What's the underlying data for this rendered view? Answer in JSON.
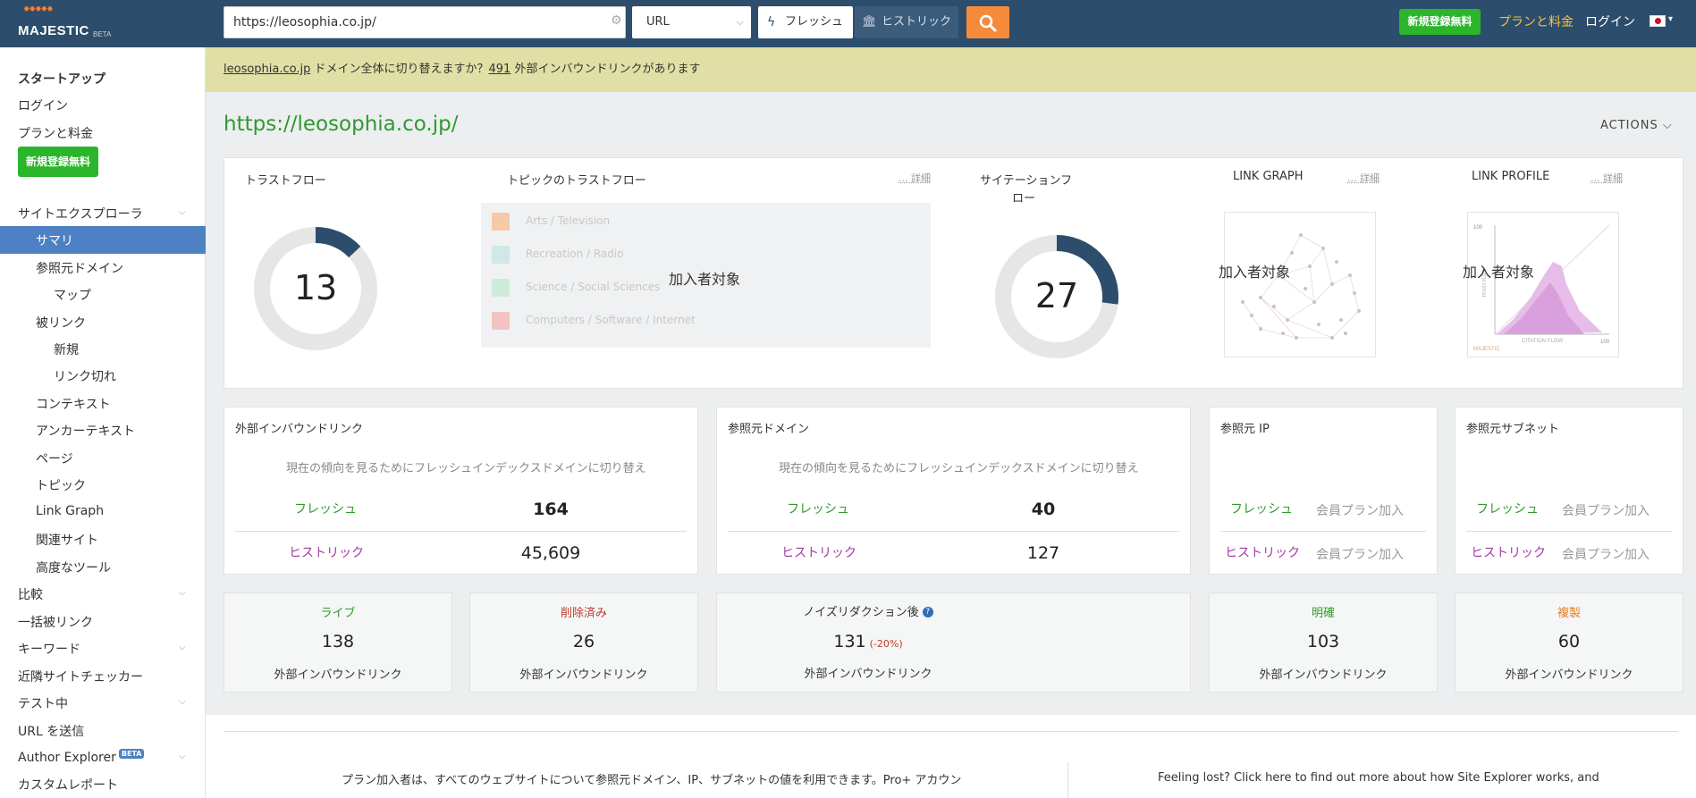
{
  "header": {
    "logo_text": "MAJESTIC",
    "logo_beta": "BETA",
    "search_value": "https://leosophia.co.jp/",
    "scope_select": "URL",
    "fresh_label": "フレッシュ",
    "historic_label": "ヒストリック",
    "signup_label": "新規登録無料",
    "plans_label": "プランと料金",
    "login_label": "ログイン"
  },
  "sidebar": {
    "startup": "スタートアップ",
    "login": "ログイン",
    "plans": "プランと料金",
    "signup": "新規登録無料",
    "site_explorer": "サイトエクスプローラ",
    "summary": "サマリ",
    "ref_domains": "参照元ドメイン",
    "map": "マップ",
    "backlinks": "被リンク",
    "new": "新規",
    "broken": "リンク切れ",
    "context": "コンテキスト",
    "anchor_text": "アンカーテキスト",
    "pages": "ページ",
    "topics": "トピック",
    "link_graph": "Link Graph",
    "related_sites": "関連サイト",
    "advanced_tools": "高度なツール",
    "compare": "比較",
    "bulk_backlinks": "一括被リンク",
    "keywords": "キーワード",
    "neighbourhood": "近隣サイトチェッカー",
    "testing": "テスト中",
    "submit_url": "URL を送信",
    "author_explorer": "Author Explorer",
    "author_beta": "BETA",
    "custom_report": "カスタムレポート"
  },
  "notice": {
    "domain_link": "leosophia.co.jp",
    "text1": " ドメイン全体に切り替えますか？",
    "count_link": "491",
    "text2": " 外部インバウンドリンクがあります"
  },
  "main": {
    "page_url": "https://leosophia.co.jp/",
    "actions_label": "ACTIONS"
  },
  "metrics": {
    "trust_flow_title": "トラストフロー",
    "trust_flow_value": "13",
    "trust_flow_level": 13,
    "topical_title": "トピックのトラストフロー",
    "detail_label": "... 詳細",
    "topics": [
      {
        "name": "Arts / Television",
        "color": "#f6c9a8"
      },
      {
        "name": "Recreation / Radio",
        "color": "#cfe8e8"
      },
      {
        "name": "Science / Social Sciences",
        "color": "#cdebd9"
      },
      {
        "name": "Computers / Software / Internet",
        "color": "#f3c3c3"
      }
    ],
    "members_only": "加入者対象",
    "citation_flow_title_1": "サイテーションフ",
    "citation_flow_title_2": "ロー",
    "citation_flow_value": "27",
    "citation_flow_level": 27,
    "link_graph_title": "LINK GRAPH",
    "link_profile_title": "LINK PROFILE",
    "lp_y_tick": "100",
    "lp_x_tick": "100",
    "lp_x_label": "CITATION FLOW",
    "lp_y_label": "TRUST FLOW",
    "lp_brand": "MAJESTIC"
  },
  "stats": {
    "switch_hint": "現在の傾向を見るためにフレッシュインデックスドメインに切り替え",
    "fresh": "フレッシュ",
    "historic": "ヒストリック",
    "members_plan": "会員プラン加入",
    "ext_backlinks_title": "外部インバウンドリンク",
    "ext_backlinks_fresh": "164",
    "ext_backlinks_historic": "45,609",
    "ref_domains_title": "参照元ドメイン",
    "ref_domains_fresh": "40",
    "ref_domains_historic": "127",
    "ref_ips_title": "参照元 IP",
    "ref_subnets_title": "参照元サブネット"
  },
  "boxes": {
    "sub_label": "外部インバウンドリンク",
    "live_label": "ライブ",
    "live_value": "138",
    "deleted_label": "削除済み",
    "deleted_value": "26",
    "noise_label": "ノイズリダクション後",
    "noise_value": "131",
    "noise_pct": "(-20%)",
    "distinct_label": "明確",
    "distinct_value": "103",
    "dup_label": "複製",
    "dup_value": "60"
  },
  "bottom": {
    "left_text": "プラン加入者は、すべてのウェブサイトについて参照元ドメイン、IP、サブネットの値を利用できます。Pro+ アカウン",
    "right_text": "Feeling lost? Click here to find out more about how Site Explorer works, and"
  },
  "colors": {
    "header_bg": "#2d4d6c",
    "accent_green": "#2bb52b",
    "search_orange": "#f58b3a",
    "ring_fill": "#2d4d6c",
    "ring_track": "#e6e6e6",
    "url_green": "#2f9a2f"
  }
}
